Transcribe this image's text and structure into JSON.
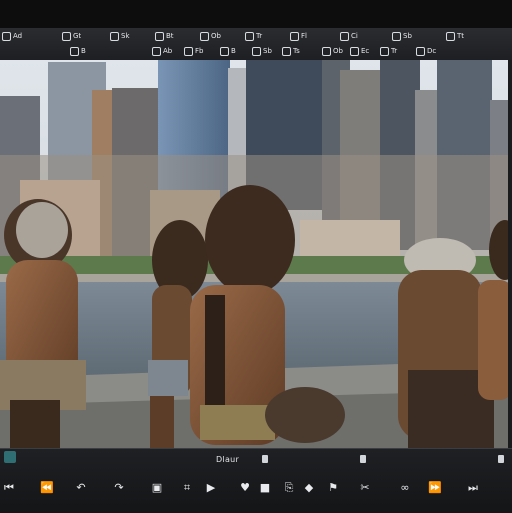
{
  "toolbar": {
    "top_items": [
      {
        "name": "file-menu",
        "label": "Ad"
      },
      {
        "name": "edit-menu",
        "label": "Gt"
      },
      {
        "name": "view-menu",
        "label": "Sk"
      },
      {
        "name": "image-menu",
        "label": "Bt"
      },
      {
        "name": "layer-menu",
        "label": "Ob"
      },
      {
        "name": "select-menu",
        "label": "Tr"
      },
      {
        "name": "filter-menu",
        "label": "Fl"
      },
      {
        "name": "tools-menu",
        "label": "Ci"
      },
      {
        "name": "window-menu",
        "label": "Sb"
      },
      {
        "name": "help-menu",
        "label": "Tt"
      }
    ],
    "bottom_items": [
      {
        "name": "tool-1",
        "label": "B"
      },
      {
        "name": "tool-2",
        "label": "Ab"
      },
      {
        "name": "tool-3",
        "label": "Fb"
      },
      {
        "name": "tool-4",
        "label": "B"
      },
      {
        "name": "tool-5",
        "label": "Sb"
      },
      {
        "name": "tool-6",
        "label": "Ts"
      },
      {
        "name": "tool-7",
        "label": "Ob"
      },
      {
        "name": "tool-8",
        "label": "Ec"
      },
      {
        "name": "tool-9",
        "label": "Tr"
      },
      {
        "name": "tool-10",
        "label": "Dc"
      }
    ]
  },
  "status": {
    "label": "Dlaur"
  },
  "controls": [
    {
      "name": "rewind-icon",
      "glyph": "⏮"
    },
    {
      "name": "step-back-icon",
      "glyph": "⏪"
    },
    {
      "name": "undo-icon",
      "glyph": "↶"
    },
    {
      "name": "redo-icon",
      "glyph": "↷"
    },
    {
      "name": "frame-icon",
      "glyph": "▣"
    },
    {
      "name": "crop-icon",
      "glyph": "⌗"
    },
    {
      "name": "play-icon",
      "glyph": "▶"
    },
    {
      "name": "heart-icon",
      "glyph": "♥"
    },
    {
      "name": "stop-icon",
      "glyph": "■"
    },
    {
      "name": "split-icon",
      "glyph": "⎘"
    },
    {
      "name": "marker-icon",
      "glyph": "◆"
    },
    {
      "name": "flag-icon",
      "glyph": "⚑"
    },
    {
      "name": "cut-icon",
      "glyph": "✂"
    },
    {
      "name": "link-icon",
      "glyph": "∞"
    },
    {
      "name": "step-forward-icon",
      "glyph": "⏩"
    },
    {
      "name": "end-icon",
      "glyph": "⏭"
    }
  ]
}
